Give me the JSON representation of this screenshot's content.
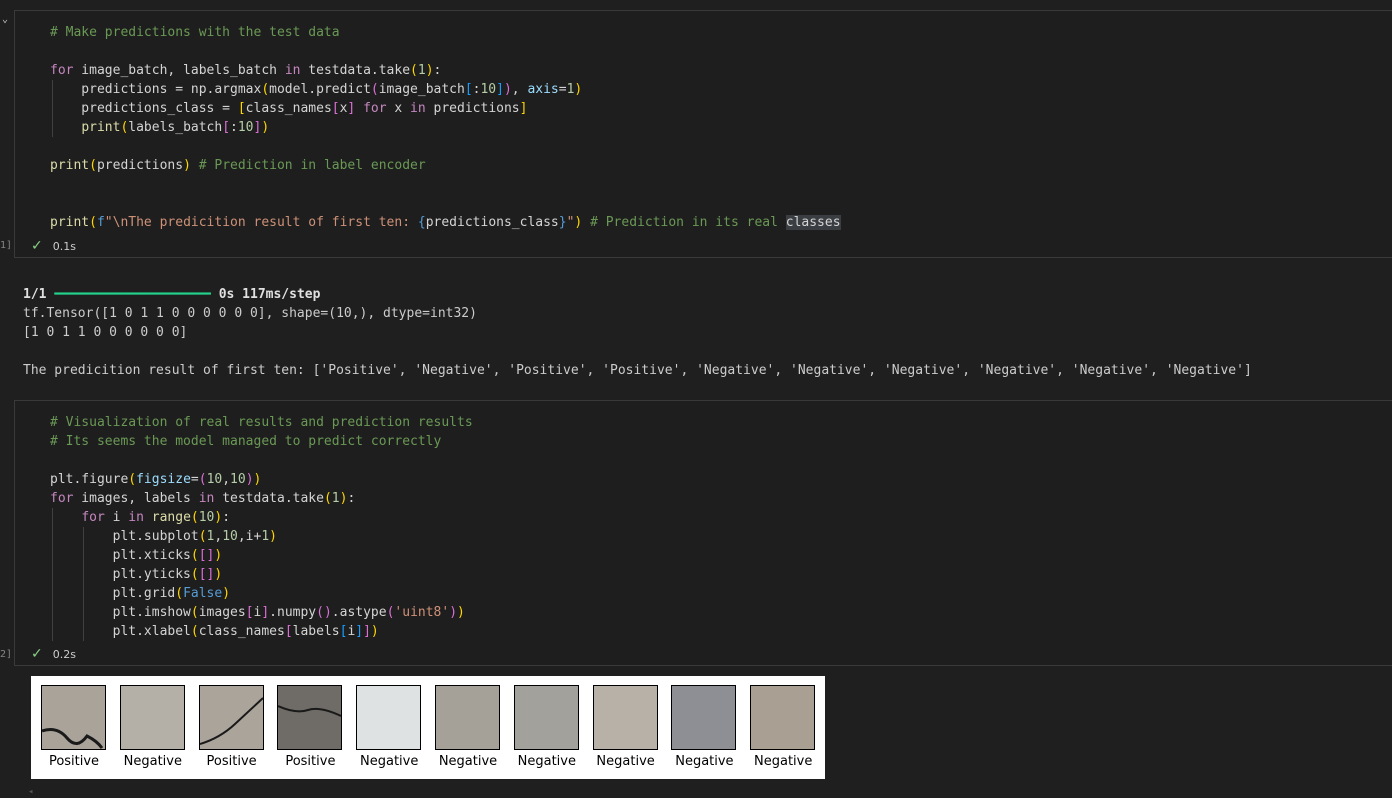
{
  "cell1": {
    "exec_label": "1]",
    "status": {
      "time": "0.1s"
    },
    "lines": [
      [
        [
          "c",
          "# Make predictions with the test data"
        ]
      ],
      [],
      [
        [
          "k",
          "for"
        ],
        [
          "t",
          " image_batch, labels_batch "
        ],
        [
          "k",
          "in"
        ],
        [
          "t",
          " testdata.take"
        ],
        [
          "y",
          "("
        ],
        [
          "n",
          "1"
        ],
        [
          "y",
          ")"
        ],
        [
          "t",
          ":"
        ]
      ],
      [
        [
          "t",
          "    predictions = np.argmax"
        ],
        [
          "y",
          "("
        ],
        [
          "t",
          "model.predict"
        ],
        [
          "m",
          "("
        ],
        [
          "t",
          "image_batch"
        ],
        [
          "l",
          "["
        ],
        [
          "t",
          ":"
        ],
        [
          "n",
          "10"
        ],
        [
          "l",
          "]"
        ],
        [
          "m",
          ")"
        ],
        [
          "t",
          ", "
        ],
        [
          "p",
          "axis"
        ],
        [
          "t",
          "="
        ],
        [
          "n",
          "1"
        ],
        [
          "y",
          ")"
        ]
      ],
      [
        [
          "t",
          "    predictions_class = "
        ],
        [
          "y",
          "["
        ],
        [
          "t",
          "class_names"
        ],
        [
          "m",
          "["
        ],
        [
          "t",
          "x"
        ],
        [
          "m",
          "]"
        ],
        [
          "t",
          " "
        ],
        [
          "k",
          "for"
        ],
        [
          "t",
          " x "
        ],
        [
          "k",
          "in"
        ],
        [
          "t",
          " predictions"
        ],
        [
          "y",
          "]"
        ]
      ],
      [
        [
          "t",
          "    "
        ],
        [
          "f",
          "print"
        ],
        [
          "y",
          "("
        ],
        [
          "t",
          "labels_batch"
        ],
        [
          "m",
          "["
        ],
        [
          "t",
          ":"
        ],
        [
          "n",
          "10"
        ],
        [
          "m",
          "]"
        ],
        [
          "y",
          ")"
        ]
      ],
      [],
      [
        [
          "f",
          "print"
        ],
        [
          "y",
          "("
        ],
        [
          "t",
          "predictions"
        ],
        [
          "y",
          ")"
        ],
        [
          "t",
          " "
        ],
        [
          "c",
          "# Prediction in label encoder"
        ]
      ],
      [],
      [],
      [
        [
          "f",
          "print"
        ],
        [
          "y",
          "("
        ],
        [
          "b",
          "f"
        ],
        [
          "s",
          "\""
        ],
        [
          "s",
          "\\nThe predicition result of first ten: "
        ],
        [
          "b",
          "{"
        ],
        [
          "t",
          "predictions_class"
        ],
        [
          "b",
          "}"
        ],
        [
          "s",
          "\""
        ],
        [
          "y",
          ")"
        ],
        [
          "t",
          " "
        ],
        [
          "c",
          "# Prediction in its real "
        ],
        [
          "hl",
          "classes"
        ]
      ]
    ]
  },
  "output": {
    "progress_count": "1/1",
    "progress_bar": "━━━━━━━━━━━━━━━━━━━━",
    "progress_rest": "0s 117ms/step",
    "tensor_line": "tf.Tensor([1 0 1 1 0 0 0 0 0 0], shape=(10,), dtype=int32)",
    "array_line": "[1 0 1 1 0 0 0 0 0 0]",
    "result_line": "The predicition result of first ten: ['Positive', 'Negative', 'Positive', 'Positive', 'Negative', 'Negative', 'Negative', 'Negative', 'Negative', 'Negative']"
  },
  "cell2": {
    "exec_label": "2]",
    "status": {
      "time": "0.2s"
    },
    "lines": [
      [
        [
          "c",
          "# Visualization of real results and prediction results"
        ]
      ],
      [
        [
          "c",
          "# Its seems the model managed to predict correctly"
        ]
      ],
      [],
      [
        [
          "t",
          "plt.figure"
        ],
        [
          "y",
          "("
        ],
        [
          "p",
          "figsize"
        ],
        [
          "t",
          "="
        ],
        [
          "m",
          "("
        ],
        [
          "n",
          "10"
        ],
        [
          "t",
          ","
        ],
        [
          "n",
          "10"
        ],
        [
          "m",
          ")"
        ],
        [
          "y",
          ")"
        ]
      ],
      [
        [
          "k",
          "for"
        ],
        [
          "t",
          " images, labels "
        ],
        [
          "k",
          "in"
        ],
        [
          "t",
          " testdata.take"
        ],
        [
          "y",
          "("
        ],
        [
          "n",
          "1"
        ],
        [
          "y",
          ")"
        ],
        [
          "t",
          ":"
        ]
      ],
      [
        [
          "t",
          "    "
        ],
        [
          "k",
          "for"
        ],
        [
          "t",
          " i "
        ],
        [
          "k",
          "in"
        ],
        [
          "t",
          " "
        ],
        [
          "f",
          "range"
        ],
        [
          "y",
          "("
        ],
        [
          "n",
          "10"
        ],
        [
          "y",
          ")"
        ],
        [
          "t",
          ":"
        ]
      ],
      [
        [
          "t",
          "        plt.subplot"
        ],
        [
          "y",
          "("
        ],
        [
          "n",
          "1"
        ],
        [
          "t",
          ","
        ],
        [
          "n",
          "10"
        ],
        [
          "t",
          ",i+"
        ],
        [
          "n",
          "1"
        ],
        [
          "y",
          ")"
        ]
      ],
      [
        [
          "t",
          "        plt.xticks"
        ],
        [
          "y",
          "("
        ],
        [
          "m",
          "["
        ],
        [
          "m",
          "]"
        ],
        [
          "y",
          ")"
        ]
      ],
      [
        [
          "t",
          "        plt.yticks"
        ],
        [
          "y",
          "("
        ],
        [
          "m",
          "["
        ],
        [
          "m",
          "]"
        ],
        [
          "y",
          ")"
        ]
      ],
      [
        [
          "t",
          "        plt.grid"
        ],
        [
          "y",
          "("
        ],
        [
          "b",
          "False"
        ],
        [
          "y",
          ")"
        ]
      ],
      [
        [
          "t",
          "        plt.imshow"
        ],
        [
          "y",
          "("
        ],
        [
          "t",
          "images"
        ],
        [
          "m",
          "["
        ],
        [
          "t",
          "i"
        ],
        [
          "m",
          "]"
        ],
        [
          "t",
          ".numpy"
        ],
        [
          "m",
          "("
        ],
        [
          "m",
          ")"
        ],
        [
          "t",
          ".astype"
        ],
        [
          "m",
          "("
        ],
        [
          "s",
          "'uint8'"
        ],
        [
          "m",
          ")"
        ],
        [
          "y",
          ")"
        ]
      ],
      [
        [
          "t",
          "        plt.xlabel"
        ],
        [
          "y",
          "("
        ],
        [
          "t",
          "class_names"
        ],
        [
          "m",
          "["
        ],
        [
          "t",
          "labels"
        ],
        [
          "l",
          "["
        ],
        [
          "t",
          "i"
        ],
        [
          "l",
          "]"
        ],
        [
          "m",
          "]"
        ],
        [
          "y",
          ")"
        ]
      ]
    ]
  },
  "figure": {
    "labels": [
      "Positive",
      "Negative",
      "Positive",
      "Positive",
      "Negative",
      "Negative",
      "Negative",
      "Negative",
      "Negative",
      "Negative"
    ],
    "thumb_colors": [
      "#a9a39a",
      "#b4b0a8",
      "#aaa49b",
      "#6f6b66",
      "#dfe2e3",
      "#a6a198",
      "#a3a19c",
      "#b7b1a8",
      "#8d8f94",
      "#a99f93"
    ]
  }
}
